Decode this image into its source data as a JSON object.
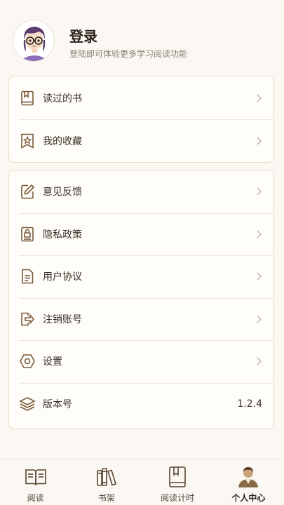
{
  "colors": {
    "accent": "#7a5a3a",
    "background": "#fbf8f3",
    "card_border": "#ead9bf"
  },
  "header": {
    "title": "登录",
    "subtitle": "登陆即可体验更多学习阅读功能",
    "avatar_icon": "avatar-girl-glasses"
  },
  "card1": {
    "items": [
      {
        "label": "读过的书",
        "icon": "book-bookmark-icon"
      },
      {
        "label": "我的收藏",
        "icon": "star-badge-icon"
      }
    ]
  },
  "card2": {
    "items": [
      {
        "label": "意见反馈",
        "icon": "edit-icon"
      },
      {
        "label": "隐私政策",
        "icon": "lock-document-icon"
      },
      {
        "label": "用户协议",
        "icon": "document-icon"
      },
      {
        "label": "注销账号",
        "icon": "logout-icon"
      },
      {
        "label": "设置",
        "icon": "hexagon-settings-icon"
      },
      {
        "label": "版本号",
        "icon": "layers-icon",
        "value": "1.2.4"
      }
    ]
  },
  "tabbar": {
    "tabs": [
      {
        "label": "阅读",
        "icon": "open-book-icon",
        "active": false
      },
      {
        "label": "书架",
        "icon": "bookshelf-icon",
        "active": false
      },
      {
        "label": "阅读计时",
        "icon": "book-timer-icon",
        "active": false
      },
      {
        "label": "个人中心",
        "icon": "person-icon",
        "active": true
      }
    ]
  }
}
